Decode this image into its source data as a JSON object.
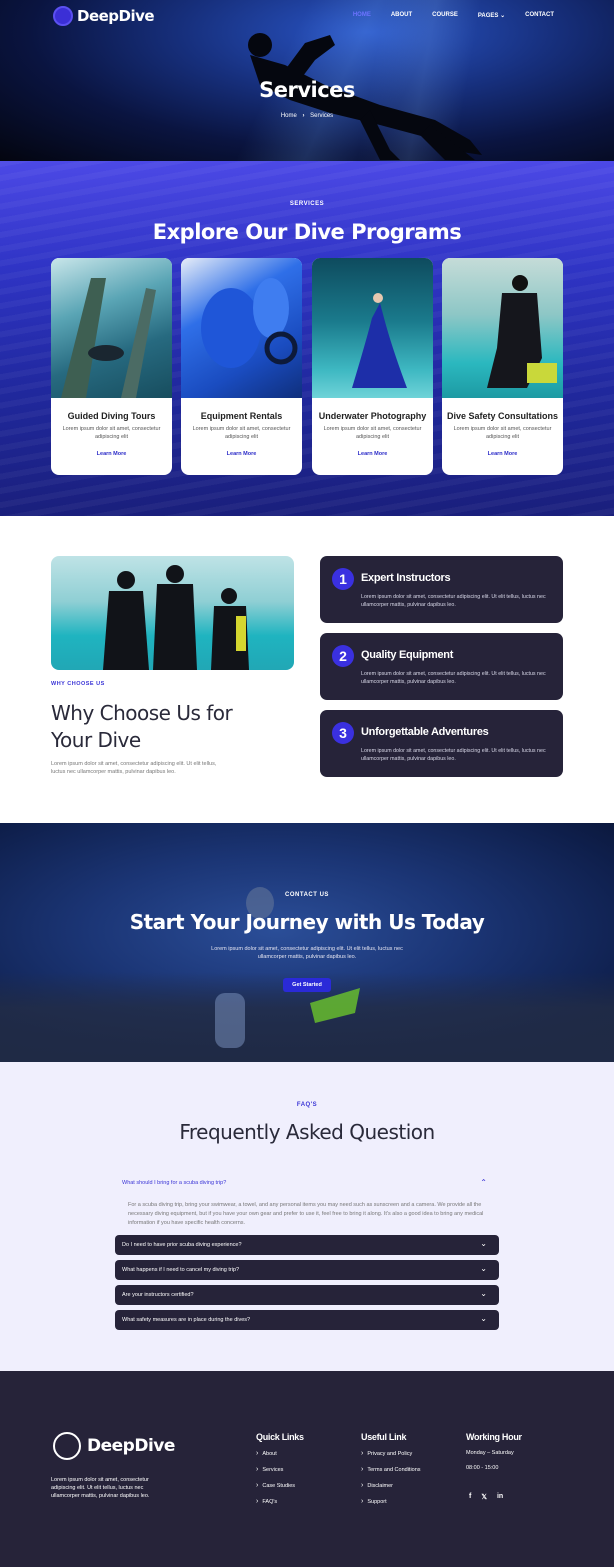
{
  "header": {
    "logo_text": "DeepDive",
    "nav": [
      {
        "label": "HOME",
        "active": true
      },
      {
        "label": "ABOUT"
      },
      {
        "label": "COURSE"
      },
      {
        "label": "PAGES"
      },
      {
        "label": "CONTACT"
      }
    ],
    "page_title": "Services",
    "breadcrumb_home": "Home",
    "breadcrumb_current": "Services"
  },
  "services": {
    "kicker": "SERVICES",
    "title": "Explore Our Dive Programs",
    "cards": [
      {
        "title": "Guided Diving Tours",
        "text": "Lorem ipsum dolor sit amet, consectetur adipiscing elit",
        "link": "Learn More"
      },
      {
        "title": "Equipment Rentals",
        "text": "Lorem ipsum dolor sit amet, consectetur adipiscing elit",
        "link": "Learn More"
      },
      {
        "title": "Underwater Photography",
        "text": "Lorem ipsum dolor sit amet, consectetur adipiscing elit",
        "link": "Learn More"
      },
      {
        "title": "Dive Safety Consultations",
        "text": "Lorem ipsum dolor sit amet, consectetur adipiscing elit",
        "link": "Learn More"
      }
    ]
  },
  "why": {
    "kicker": "WHY CHOOSE US",
    "title": "Why Choose Us for Your Dive",
    "desc": "Lorem ipsum dolor sit amet, consectetur adipiscing elit. Ut elit tellus, luctus nec ullamcorper mattis, pulvinar dapibus leo.",
    "features": [
      {
        "num": "1",
        "title": "Expert Instructors",
        "text": "Lorem ipsum dolor sit amet, consectetur adipiscing elit. Ut elit tellus, luctus nec ullamcorper mattis, pulvinar dapibus leo."
      },
      {
        "num": "2",
        "title": "Quality Equipment",
        "text": "Lorem ipsum dolor sit amet, consectetur adipiscing elit. Ut elit tellus, luctus nec ullamcorper mattis, pulvinar dapibus leo."
      },
      {
        "num": "3",
        "title": "Unforgettable Adventures",
        "text": "Lorem ipsum dolor sit amet, consectetur adipiscing elit. Ut elit tellus, luctus nec ullamcorper mattis, pulvinar dapibus leo."
      }
    ]
  },
  "cta": {
    "kicker": "CONTACT US",
    "title": "Start Your Journey with Us Today",
    "desc": "Lorem ipsum dolor sit amet, consectetur adipiscing elit. Ut elit tellus, luctus nec ullamcorper mattis, pulvinar dapibus leo.",
    "button": "Get Started"
  },
  "faq": {
    "kicker": "FAQ'S",
    "title": "Frequently Asked Question",
    "open_question": "What should I bring for a scuba diving trip?",
    "open_answer": "For a scuba diving trip, bring your swimwear, a towel, and any personal items you may need such as sunscreen and a camera. We provide all the necessary diving equipment, but if you have your own gear and prefer to use it, feel free to bring it along. It's also a good idea to bring any medical information if you have specific health concerns.",
    "items": [
      "Do I need to have prior scuba diving experience?",
      "What happens if I need to cancel my diving trip?",
      "Are your instructors certified?",
      "What safety measures are in place during the dives?"
    ]
  },
  "footer": {
    "logo_text": "DeepDive",
    "desc": "Lorem ipsum dolor sit amet, consectetur adipiscing elit. Ut elit tellus, luctus nec ullamcorper mattis, pulvinar dapibus leo.",
    "quick_title": "Quick Links",
    "quick_links": [
      "About",
      "Services",
      "Case Studies",
      "FAQ's"
    ],
    "useful_title": "Useful Link",
    "useful_links": [
      "Privacy and Policy",
      "Terms and Conditions",
      "Disclaimer",
      "Support"
    ],
    "hours_title": "Working Hour",
    "hours_days": "Monday – Saturday",
    "hours_time": "08:00 - 15:00",
    "social": [
      "f",
      "𝕏",
      "in"
    ]
  },
  "colors": {
    "accent": "#3a34d6",
    "dark": "#262339"
  }
}
